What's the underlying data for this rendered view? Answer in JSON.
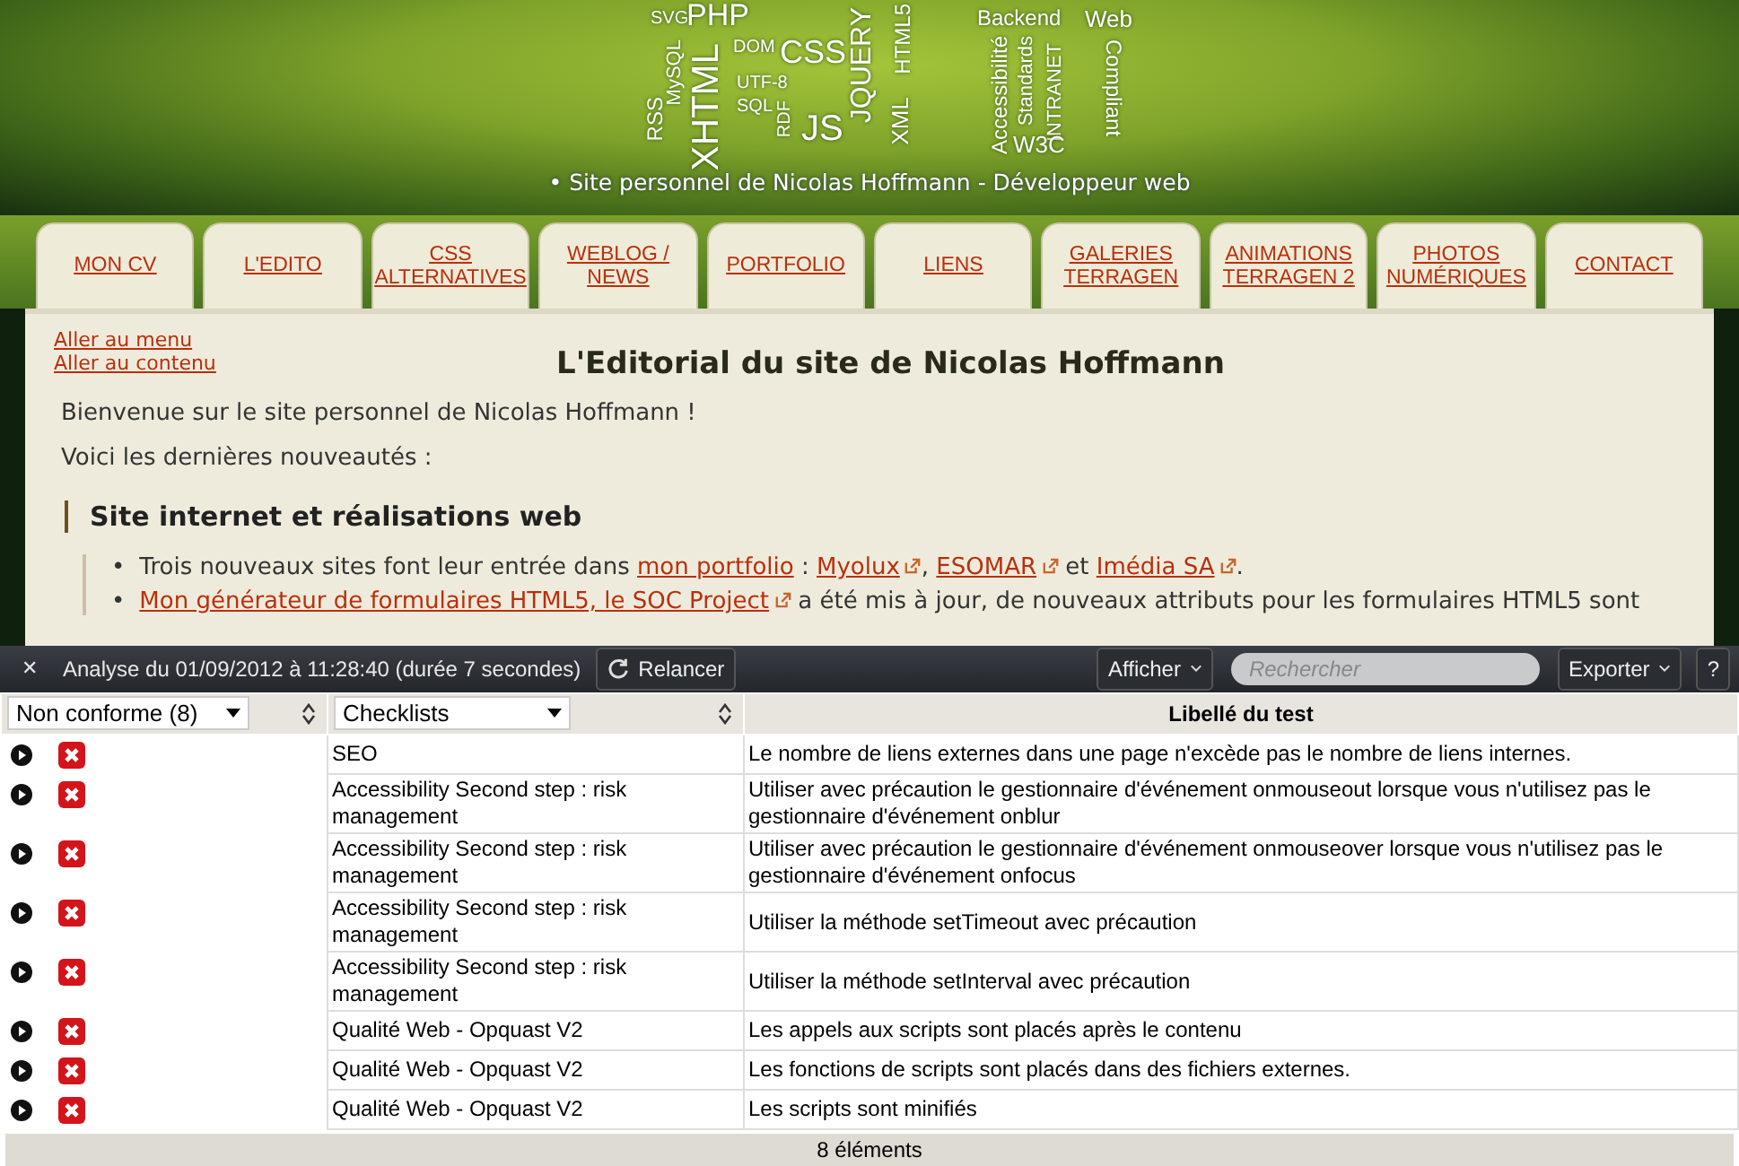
{
  "banner": {
    "logo_words": [
      "SVG",
      "PHP",
      "RSS",
      "MySQL",
      "XHTML",
      "DOM",
      "CSS",
      "UTF-8",
      "SQL",
      "RDF",
      "JS",
      "JQUERY",
      "XML",
      "HTML5"
    ],
    "logo_words_right": [
      "Backend",
      "Web",
      "Accessibilité",
      "Standards",
      "INTRANET",
      "W3C",
      "Compliant"
    ],
    "tagline": "• Site personnel de Nicolas Hoffmann - Développeur web"
  },
  "nav": [
    {
      "lines": [
        "MON CV"
      ]
    },
    {
      "lines": [
        "L'EDITO"
      ]
    },
    {
      "lines": [
        "CSS",
        "ALTERNATIVES"
      ]
    },
    {
      "lines": [
        "WEBLOG /",
        "NEWS"
      ]
    },
    {
      "lines": [
        "PORTFOLIO"
      ]
    },
    {
      "lines": [
        "LIENS"
      ]
    },
    {
      "lines": [
        "GALERIES",
        "TERRAGEN"
      ]
    },
    {
      "lines": [
        "ANIMATIONS",
        "TERRAGEN 2"
      ]
    },
    {
      "lines": [
        "PHOTOS",
        "NUMÉRIQUES"
      ]
    },
    {
      "lines": [
        "CONTACT"
      ]
    }
  ],
  "skip_links": [
    "Aller au menu",
    "Aller au contenu"
  ],
  "page_title": "L'Editorial du site de Nicolas Hoffmann",
  "paragraphs": [
    "Bienvenue sur le site personnel de Nicolas Hoffmann !",
    "Voici les dernières nouveautés :"
  ],
  "section_title": "Site internet et réalisations web",
  "bullet": "•",
  "news": [
    [
      {
        "kind": "text",
        "text": "Trois nouveaux sites font leur entrée dans "
      },
      {
        "kind": "link",
        "text": "mon portfolio"
      },
      {
        "kind": "text",
        "text": " : "
      },
      {
        "kind": "extlink",
        "text": "Myolux"
      },
      {
        "kind": "text",
        "text": ", "
      },
      {
        "kind": "extlink",
        "text": "ESOMAR"
      },
      {
        "kind": "text",
        "text": " et "
      },
      {
        "kind": "extlink",
        "text": "Imédia SA"
      },
      {
        "kind": "text",
        "text": "."
      }
    ],
    [
      {
        "kind": "extlink",
        "text": "Mon générateur de formulaires HTML5, le SOC Project"
      },
      {
        "kind": "text",
        "text": " a été mis à jour, de nouveaux attributs pour les formulaires HTML5 sont"
      }
    ]
  ],
  "devtools": {
    "close": "✕",
    "title": "Analyse du 01/09/2012 à 11:28:40 (durée 7 secondes)",
    "rerun": "Relancer",
    "show": "Afficher",
    "search": {
      "placeholder": "Rechercher"
    },
    "export": "Exporter",
    "help": "?",
    "filters": [
      "Non conforme (8)",
      "Checklists"
    ],
    "column_3": "Libellé du test",
    "rows": [
      {
        "checklist": "SEO",
        "test": "Le nombre de liens externes dans une page n'excède pas le nombre de liens internes."
      },
      {
        "checklist": "Accessibility Second step : risk management",
        "test": "Utiliser avec précaution le gestionnaire d'événement onmouseout lorsque vous n'utilisez pas le gestionnaire d'événement onblur"
      },
      {
        "checklist": "Accessibility Second step : risk management",
        "test": "Utiliser avec précaution le gestionnaire d'événement onmouseover lorsque vous n'utilisez pas le gestionnaire d'événement onfocus"
      },
      {
        "checklist": "Accessibility Second step : risk management",
        "test": "Utiliser la méthode setTimeout avec précaution"
      },
      {
        "checklist": "Accessibility Second step : risk management",
        "test": "Utiliser la méthode setInterval avec précaution"
      },
      {
        "checklist": "Qualité Web - Opquast V2",
        "test": "Les appels aux scripts sont placés après le contenu"
      },
      {
        "checklist": "Qualité Web - Opquast V2",
        "test": "Les fonctions de scripts sont placés dans des fichiers externes."
      },
      {
        "checklist": "Qualité Web - Opquast V2",
        "test": "Les scripts sont minifiés"
      }
    ],
    "footer": "8 éléments"
  }
}
